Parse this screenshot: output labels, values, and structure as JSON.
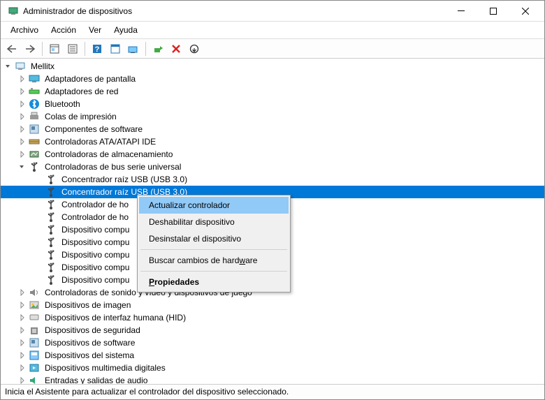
{
  "window": {
    "title": "Administrador de dispositivos"
  },
  "menu": {
    "file": "Archivo",
    "action": "Acción",
    "view": "Ver",
    "help": "Ayuda"
  },
  "tree": {
    "root": "Mellitx",
    "cats": [
      {
        "name": "Adaptadores de pantalla",
        "icon": "display"
      },
      {
        "name": "Adaptadores de red",
        "icon": "net"
      },
      {
        "name": "Bluetooth",
        "icon": "bt"
      },
      {
        "name": "Colas de impresión",
        "icon": "printer"
      },
      {
        "name": "Componentes de software",
        "icon": "sw"
      },
      {
        "name": "Controladoras ATA/ATAPI IDE",
        "icon": "ide"
      },
      {
        "name": "Controladoras de almacenamiento",
        "icon": "storage"
      },
      {
        "name": "Controladoras de bus serie universal",
        "icon": "usb",
        "expanded": true,
        "children": [
          "Concentrador raíz USB (USB 3.0)",
          "Concentrador raíz USB (USB 3.0)",
          "Controlador de ho",
          "Controlador de ho",
          "Dispositivo compu",
          "Dispositivo compu",
          "Dispositivo compu",
          "Dispositivo compu",
          "Dispositivo compu"
        ],
        "selectedChild": 1
      },
      {
        "name": "Controladoras de sonido y vídeo y dispositivos de juego",
        "icon": "sound"
      },
      {
        "name": "Dispositivos de imagen",
        "icon": "image"
      },
      {
        "name": "Dispositivos de interfaz humana (HID)",
        "icon": "hid"
      },
      {
        "name": "Dispositivos de seguridad",
        "icon": "sec"
      },
      {
        "name": "Dispositivos de software",
        "icon": "sw"
      },
      {
        "name": "Dispositivos del sistema",
        "icon": "system"
      },
      {
        "name": "Dispositivos multimedia digitales",
        "icon": "media"
      },
      {
        "name": "Entradas y salidas de audio",
        "icon": "audio"
      }
    ]
  },
  "context": {
    "update": "Actualizar controlador",
    "disable": "Deshabilitar dispositivo",
    "uninstall": "Desinstalar el dispositivo",
    "scan_pre": "Buscar cambios de hard",
    "scan_u": "w",
    "scan_post": "are",
    "props_u": "P",
    "props_post": "ropiedades"
  },
  "status": "Inicia el Asistente para actualizar el controlador del dispositivo seleccionado."
}
